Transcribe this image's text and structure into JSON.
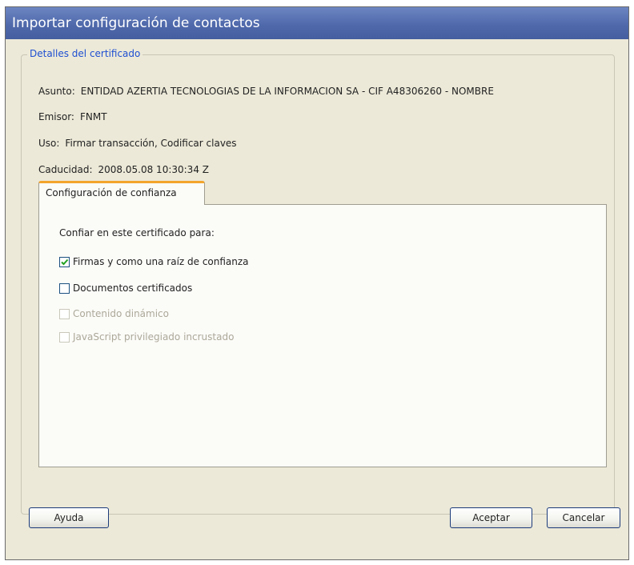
{
  "window": {
    "title": "Importar configuración de contactos"
  },
  "certificate": {
    "legend": "Detalles del certificado",
    "subject": {
      "label": "Asunto:",
      "value": "ENTIDAD AZERTIA TECNOLOGIAS DE LA INFORMACION SA - CIF A48306260 - NOMBRE"
    },
    "issuer": {
      "label": "Emisor:",
      "value": "FNMT"
    },
    "usage": {
      "label": "Uso:",
      "value": "Firmar transacción, Codificar claves"
    },
    "expiry": {
      "label": "Caducidad:",
      "value": "2008.05.08 10:30:34 Z"
    }
  },
  "tab": {
    "label": "Configuración de confianza"
  },
  "trust": {
    "heading": "Confiar en este certificado para:",
    "options": [
      {
        "label": "Firmas y como una raíz de confianza",
        "checked": true,
        "enabled": true
      },
      {
        "label": "Documentos certificados",
        "checked": false,
        "enabled": true
      },
      {
        "label": "Contenido dinámico",
        "checked": false,
        "enabled": false
      },
      {
        "label": "JavaScript privilegiado incrustado",
        "checked": false,
        "enabled": false
      }
    ]
  },
  "buttons": {
    "help": "Ayuda",
    "ok": "Aceptar",
    "cancel": "Cancelar"
  }
}
